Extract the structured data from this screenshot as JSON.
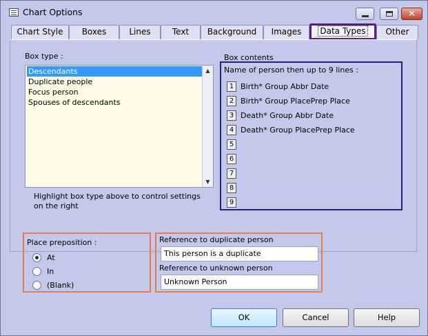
{
  "window": {
    "title": "Chart Options"
  },
  "tabs": [
    {
      "label": "Chart Style"
    },
    {
      "label": "Boxes"
    },
    {
      "label": "Lines"
    },
    {
      "label": "Text"
    },
    {
      "label": "Background"
    },
    {
      "label": "Images"
    },
    {
      "label": "Data Types",
      "active": true
    },
    {
      "label": "Other"
    }
  ],
  "box_type": {
    "label": "Box type :",
    "items": [
      {
        "label": "Descendants",
        "selected": true
      },
      {
        "label": "Duplicate people"
      },
      {
        "label": "Focus person"
      },
      {
        "label": "Spouses of descendants"
      }
    ],
    "hint": "Highlight box type above to control settings on the right"
  },
  "box_contents": {
    "label": "Box contents",
    "header": "Name of person then up to 9 lines :",
    "lines": [
      {
        "num": "1",
        "text": "Birth* Group Abbr Date"
      },
      {
        "num": "2",
        "text": "Birth* Group PlacePrep Place"
      },
      {
        "num": "3",
        "text": "Death* Group Abbr Date"
      },
      {
        "num": "4",
        "text": "Death* Group PlacePrep Place"
      },
      {
        "num": "5",
        "text": ""
      },
      {
        "num": "6",
        "text": ""
      },
      {
        "num": "7",
        "text": ""
      },
      {
        "num": "8",
        "text": ""
      },
      {
        "num": "9",
        "text": ""
      }
    ]
  },
  "place_preposition": {
    "label": "Place preposition :",
    "options": [
      {
        "label": "At",
        "checked": true
      },
      {
        "label": "In",
        "checked": false
      },
      {
        "label": "(Blank)",
        "checked": false
      }
    ]
  },
  "references": {
    "duplicate_label": "Reference to duplicate person",
    "duplicate_value": "This person is a duplicate",
    "unknown_label": "Reference to unknown person",
    "unknown_value": "Unknown Person"
  },
  "buttons": {
    "ok": "OK",
    "cancel": "Cancel",
    "help": "Help"
  },
  "colors": {
    "background": "#c4c8ea",
    "list_background": "#fffbe6",
    "selection": "#3399ff",
    "contents_border": "#1a237e",
    "highlight_border": "#e87a4d",
    "active_tab_border": "#5b1c83"
  }
}
